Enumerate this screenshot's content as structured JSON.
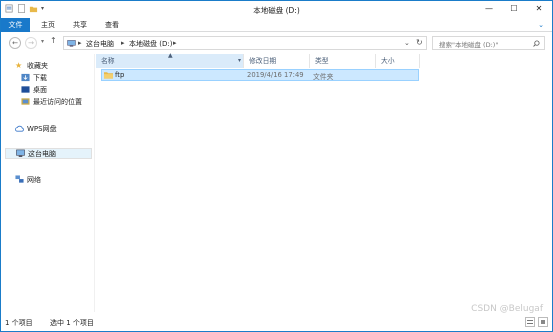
{
  "window": {
    "title": "本地磁盘 (D:)"
  },
  "ribbon": {
    "tabs": [
      "文件",
      "主页",
      "共享",
      "查看"
    ]
  },
  "address": {
    "crumbs": [
      "这台电脑",
      "本地磁盘 (D:)"
    ],
    "search_placeholder": "搜索\"本地磁盘 (D:)\""
  },
  "nav": {
    "favorites_label": "收藏夹",
    "downloads": "下载",
    "desktop": "桌面",
    "recent": "最近访问的位置",
    "wps": "WPS网盘",
    "thispc": "这台电脑",
    "network": "网络"
  },
  "columns": [
    "名称",
    "修改日期",
    "类型",
    "大小"
  ],
  "files": [
    {
      "name": "ftp",
      "modified": "2019/4/16 17:49",
      "type": "文件夹",
      "size": ""
    }
  ],
  "status": {
    "count": "1 个项目",
    "selected": "选中 1 个项目"
  },
  "watermark": "CSDN @Belugaf",
  "colors": {
    "accent": "#1979ca",
    "selection": "#cce8ff",
    "folder": "#e8b94a"
  }
}
